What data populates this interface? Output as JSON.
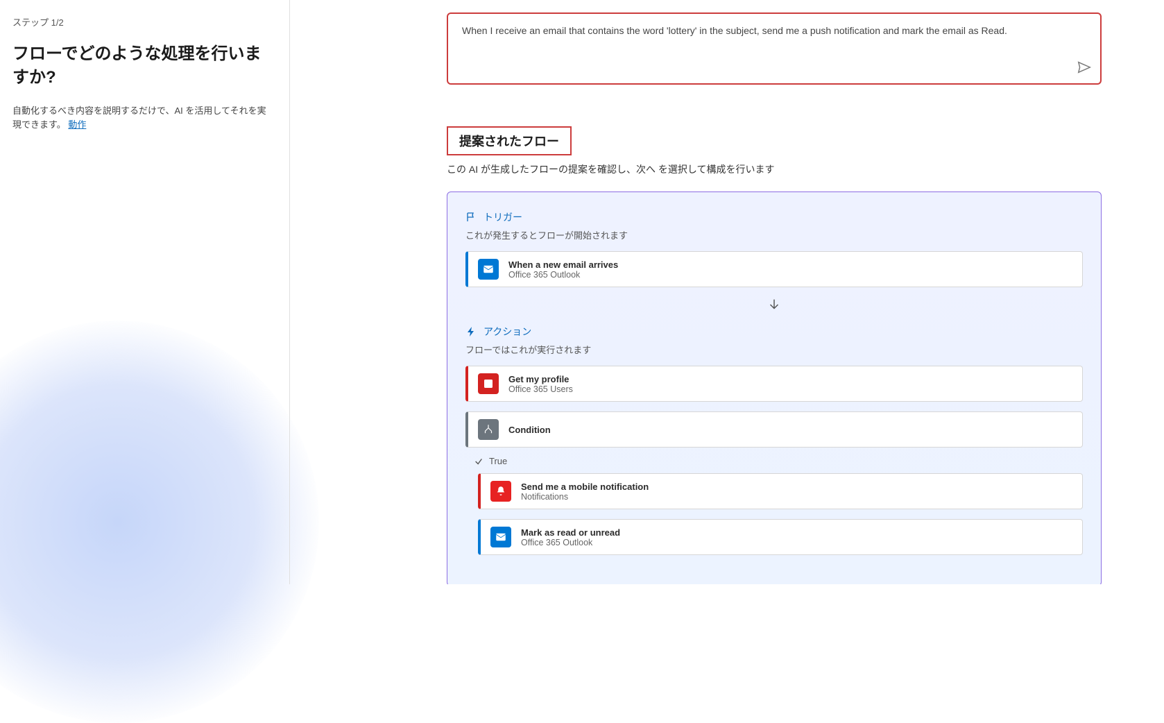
{
  "left": {
    "step_label": "ステップ 1/2",
    "title": "フローでどのような処理を行いますか?",
    "description_pre": "自動化するべき内容を説明するだけで、AI を活用してそれを実現できます。",
    "link_text": "動作"
  },
  "input": {
    "text": "When I receive an email that contains the word 'lottery' in the subject, send me a push notification and mark the email as Read."
  },
  "suggested": {
    "header": "提案されたフロー",
    "subtitle": "この AI が生成したフローの提案を確認し、次へ を選択して構成を行います"
  },
  "trigger_group": {
    "label": "トリガー",
    "desc": "これが発生するとフローが開始されます",
    "cards": [
      {
        "title": "When a new email arrives",
        "sub": "Office 365 Outlook"
      }
    ]
  },
  "action_group": {
    "label": "アクション",
    "desc": "フローではこれが実行されます",
    "cards": [
      {
        "title": "Get my profile",
        "sub": "Office 365 Users"
      },
      {
        "title": "Condition",
        "sub": ""
      }
    ],
    "branch_true": "True",
    "nested_cards": [
      {
        "title": "Send me a mobile notification",
        "sub": "Notifications"
      },
      {
        "title": "Mark as read or unread",
        "sub": "Office 365 Outlook"
      }
    ]
  }
}
